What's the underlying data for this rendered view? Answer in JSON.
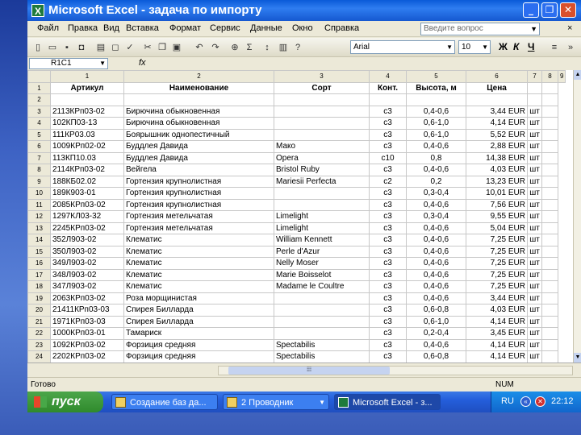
{
  "window": {
    "title": "Microsoft Excel - задача по импорту",
    "app_icon": "X",
    "minimize_icon": "_",
    "maximize_icon": "❐",
    "close_icon": "✕"
  },
  "menu": {
    "items": [
      "Файл",
      "Правка",
      "Вид",
      "Вставка",
      "Формат",
      "Сервис",
      "Данные",
      "Окно",
      "Справка"
    ],
    "help_placeholder": "Введите вопрос",
    "close_icon": "×"
  },
  "toolbar": {
    "font": "Arial",
    "size": "10",
    "bold": "Ж",
    "italic": "К",
    "underline": "Ч"
  },
  "formula_bar": {
    "name_box": "R1C1",
    "fx": "fx"
  },
  "sheet": {
    "col_headers": [
      "1",
      "2",
      "3",
      "4",
      "5",
      "6",
      "7",
      "8",
      "9"
    ],
    "header": {
      "row": "1",
      "cells": [
        "Артикул",
        "Наименование",
        "Сорт",
        "Конт.",
        "Высота, м",
        "Цена",
        ""
      ]
    },
    "rows": [
      {
        "n": "2",
        "c": [
          "",
          "",
          "",
          "",
          "",
          "",
          ""
        ]
      },
      {
        "n": "3",
        "c": [
          "2113КРп03-02",
          "Бирючина обыкновенная",
          "",
          "с3",
          "0,4-0,6",
          "3,44 EUR",
          "шт"
        ]
      },
      {
        "n": "4",
        "c": [
          "102КП03-13",
          "Бирючина обыкновенная",
          "",
          "с3",
          "0,6-1,0",
          "4,14 EUR",
          "шт"
        ]
      },
      {
        "n": "5",
        "c": [
          "111КР03.03",
          "Боярышник однопестичный",
          "",
          "с3",
          "0,6-1,0",
          "5,52 EUR",
          "шт"
        ]
      },
      {
        "n": "6",
        "c": [
          "1009КРп02-02",
          "Буддлея Давида",
          "Мако",
          "с3",
          "0,4-0,6",
          "2,88 EUR",
          "шт"
        ]
      },
      {
        "n": "7",
        "c": [
          "113КП10.03",
          "Буддлея Давида",
          "Opera",
          "с10",
          "0,8",
          "14,38 EUR",
          "шт"
        ]
      },
      {
        "n": "8",
        "c": [
          "2114КРп03-02",
          "Вейгела",
          "Bristol Ruby",
          "с3",
          "0,4-0,6",
          "4,03 EUR",
          "шт"
        ]
      },
      {
        "n": "9",
        "c": [
          "188КБ02.02",
          "Гортензия крупнолистная",
          "Mariesii Perfecta",
          "с2",
          "0,2",
          "13,23 EUR",
          "шт"
        ]
      },
      {
        "n": "10",
        "c": [
          "189К903-01",
          "Гортензия крупнолистная",
          "",
          "с3",
          "0,3-0,4",
          "10,01 EUR",
          "шт"
        ]
      },
      {
        "n": "11",
        "c": [
          "2085КРп03-02",
          "Гортензия крупнолистная",
          "",
          "с3",
          "0,4-0,6",
          "7,56 EUR",
          "шт"
        ]
      },
      {
        "n": "12",
        "c": [
          "1297КЛ03-32",
          "Гортензия метельчатая",
          "Limelight",
          "с3",
          "0,3-0,4",
          "9,55 EUR",
          "шт"
        ]
      },
      {
        "n": "13",
        "c": [
          "2245КРп03-02",
          "Гортензия метельчатая",
          "Limelight",
          "с3",
          "0,4-0,6",
          "5,04 EUR",
          "шт"
        ]
      },
      {
        "n": "14",
        "c": [
          "352Л903-02",
          "Клематис",
          "William Kennett",
          "с3",
          "0,4-0,6",
          "7,25 EUR",
          "шт"
        ]
      },
      {
        "n": "15",
        "c": [
          "350Л903-02",
          "Клематис",
          "Perle d'Azur",
          "с3",
          "0,4-0,6",
          "7,25 EUR",
          "шт"
        ]
      },
      {
        "n": "16",
        "c": [
          "349Л903-02",
          "Клематис",
          "Nelly Moser",
          "с3",
          "0,4-0,6",
          "7,25 EUR",
          "шт"
        ]
      },
      {
        "n": "17",
        "c": [
          "348Л903-02",
          "Клематис",
          "Marie Boisselot",
          "с3",
          "0,4-0,6",
          "7,25 EUR",
          "шт"
        ]
      },
      {
        "n": "18",
        "c": [
          "347Л903-02",
          "Клематис",
          "Madame le Coultre",
          "с3",
          "0,4-0,6",
          "7,25 EUR",
          "шт"
        ]
      },
      {
        "n": "19",
        "c": [
          "2063КРп03-02",
          "Роза морщинистая",
          "",
          "с3",
          "0,4-0,6",
          "3,44 EUR",
          "шт"
        ]
      },
      {
        "n": "20",
        "c": [
          "21411КРп03-03",
          "Спирея Билларда",
          "",
          "с3",
          "0,6-0,8",
          "4,03 EUR",
          "шт"
        ]
      },
      {
        "n": "21",
        "c": [
          "1971КРп03-03",
          "Спирея Билларда",
          "",
          "с3",
          "0,6-1,0",
          "4,14 EUR",
          "шт"
        ]
      },
      {
        "n": "22",
        "c": [
          "1000КРп03-01",
          "Тамариск",
          "",
          "с3",
          "0,2-0,4",
          "3,45 EUR",
          "шт"
        ]
      },
      {
        "n": "23",
        "c": [
          "1092КРп03-02",
          "Форзиция средняя",
          "Spectabilis",
          "с3",
          "0,4-0,6",
          "4,14 EUR",
          "шт"
        ]
      },
      {
        "n": "24",
        "c": [
          "2202КРп03-02",
          "Форзиция средняя",
          "Spectabilis",
          "с3",
          "0,6-0,8",
          "4,14 EUR",
          "шт"
        ]
      }
    ]
  },
  "status": {
    "ready": "Готово",
    "num": "NUM"
  },
  "taskbar": {
    "start_label": "пуск",
    "tasks": [
      "Создание баз да...",
      "2 Проводник",
      "Microsoft Excel - з..."
    ],
    "language": "RU",
    "clock": "22:12"
  },
  "colors": {
    "title_bar": "#1558d0",
    "start_button": "#3c9a3a",
    "desktop": "#3e63c4"
  }
}
